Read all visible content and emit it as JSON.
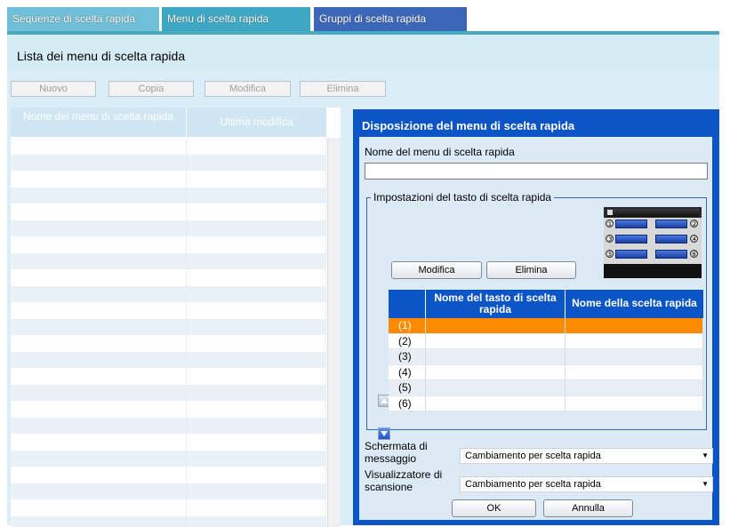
{
  "tabs": [
    {
      "label": "Sequenze di scelta rapida"
    },
    {
      "label": "Menu di scelta rapida"
    },
    {
      "label": "Gruppi di scelta rapida"
    }
  ],
  "page_title": "Lista dei menu di scelta rapida",
  "toolbar": {
    "new_label": "Nuovo",
    "copy_label": "Copia",
    "edit_label": "Modifica",
    "delete_label": "Elimina"
  },
  "list": {
    "col_name": "Nome del menu di scelta rapida",
    "col_modified": "Ultima modifica",
    "row_count": 24
  },
  "dialog": {
    "title": "Disposizione del menu di scelta rapida",
    "menu_name_label": "Nome del menu di scelta rapida",
    "menu_name_value": "",
    "key_settings_legend": "Impostazioni del tasto di scelta rapida",
    "edit_label": "Modifica",
    "delete_label": "Elimina",
    "table": {
      "col_key_name": "Nome del tasto di scelta rapida",
      "col_shortcut_name": "Nome della scelta rapida",
      "rows": [
        {
          "num": "(1)",
          "key_name": "",
          "shortcut_name": "",
          "selected": true
        },
        {
          "num": "(2)",
          "key_name": "",
          "shortcut_name": "",
          "selected": false
        },
        {
          "num": "(3)",
          "key_name": "",
          "shortcut_name": "",
          "selected": false
        },
        {
          "num": "(4)",
          "key_name": "",
          "shortcut_name": "",
          "selected": false
        },
        {
          "num": "(5)",
          "key_name": "",
          "shortcut_name": "",
          "selected": false
        },
        {
          "num": "(6)",
          "key_name": "",
          "shortcut_name": "",
          "selected": false
        }
      ]
    },
    "preview_numbers": [
      "①",
      "②",
      "③",
      "④",
      "⑤",
      "⑥"
    ],
    "message_screen_label": "Schermata di messaggio",
    "message_screen_value": "Cambiamento per scelta rapida",
    "scan_viewer_label": "Visualizzatore di scansione",
    "scan_viewer_value": "Cambiamento per scelta rapida",
    "ok_label": "OK",
    "cancel_label": "Annulla"
  },
  "colors": {
    "dialog_blue": "#0b55c6",
    "selected_row": "#ff8c00",
    "panel_bg": "#dbedf6"
  }
}
